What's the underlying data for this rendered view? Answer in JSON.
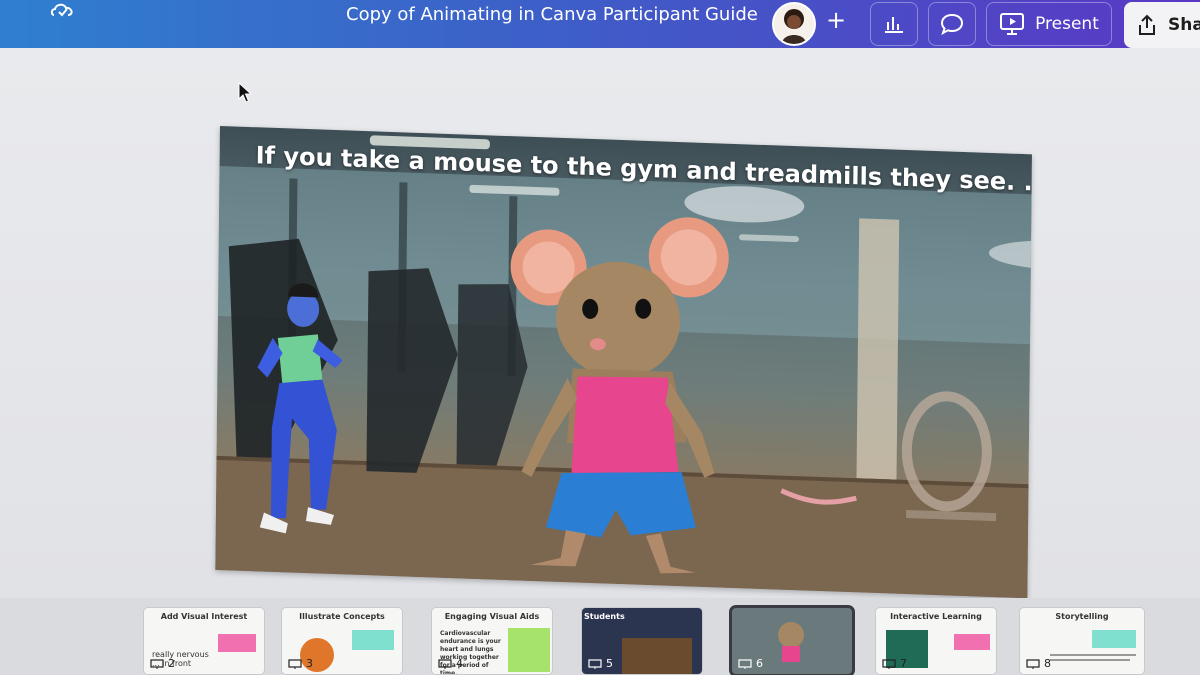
{
  "header": {
    "title": "Copy of Animating in Canva Participant Guide",
    "present_label": "Present",
    "share_label": "Sha"
  },
  "slide": {
    "heading": "If you take a mouse to the gym and treadmills they see. . ."
  },
  "filmstrip": {
    "pages": [
      {
        "title": "Add Visual Interest",
        "number": "2",
        "body": "really nervous ... in front"
      },
      {
        "title": "Illustrate Concepts",
        "number": "3"
      },
      {
        "title": "Engaging Visual Aids",
        "number": "4",
        "body": "Cardiovascular endurance is your heart and lungs working together for a period of time."
      },
      {
        "title": "Students",
        "number": "5"
      },
      {
        "title": "",
        "number": "6"
      },
      {
        "title": "Interactive Learning",
        "number": "7"
      },
      {
        "title": "Storytelling",
        "number": "8"
      }
    ]
  },
  "colors": {
    "header_start": "#2f7fcf",
    "header_end": "#5a38c4",
    "mouse_top": "#e8458f",
    "mouse_shorts": "#2a7fd4"
  }
}
